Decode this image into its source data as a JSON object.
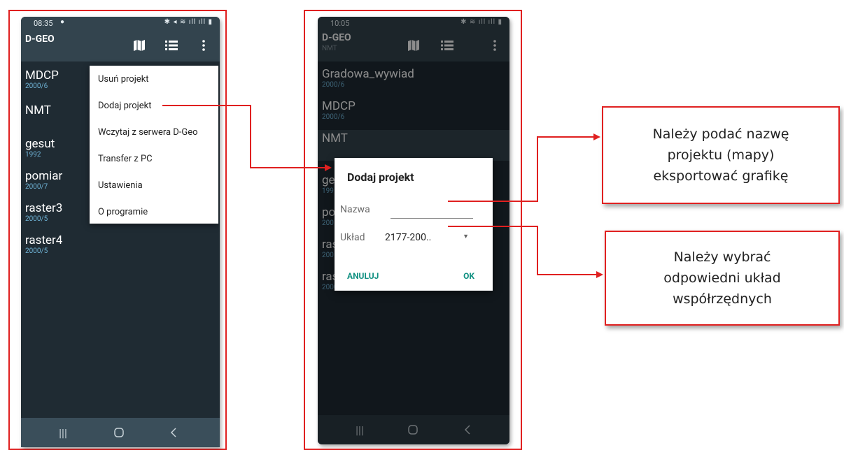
{
  "left_phone": {
    "status_time": "08:35",
    "app_title": "D-GEO",
    "projects": [
      {
        "name": "MDCP",
        "sub": "2000/6"
      },
      {
        "name": "NMT",
        "sub": ""
      },
      {
        "name": "gesut",
        "sub": "1992"
      },
      {
        "name": "pomiar",
        "sub": "2000/7"
      },
      {
        "name": "raster3",
        "sub": "2000/5"
      },
      {
        "name": "raster4",
        "sub": "2000/5"
      }
    ],
    "menu": [
      "Usuń projekt",
      "Dodaj projekt",
      "Wczytaj z serwera D-Geo",
      "Transfer z PC",
      "Ustawienia",
      "O programie"
    ]
  },
  "right_phone": {
    "status_time": "10:05",
    "app_title": "D-GEO",
    "app_subtitle": "NMT",
    "projects": [
      {
        "name": "Gradowa_wywiad",
        "sub": "2000/6"
      },
      {
        "name": "MDCP",
        "sub": "2000/6"
      },
      {
        "name": "NMT",
        "sub": ""
      },
      {
        "name": "ge",
        "sub": "199"
      },
      {
        "name": "po",
        "sub": "200"
      },
      {
        "name": "ras",
        "sub": "200"
      },
      {
        "name": "ras",
        "sub": "2000/5"
      }
    ],
    "dialog": {
      "title": "Dodaj projekt",
      "name_label": "Nazwa",
      "name_value": "",
      "system_label": "Układ",
      "system_value": "2177-200..",
      "cancel": "ANULUJ",
      "ok": "OK"
    }
  },
  "callouts": {
    "name_hint": [
      "Należy podać nazwę",
      "projektu (mapy)",
      "eksportować grafikę"
    ],
    "system_hint": [
      "Należy wybrać",
      "odpowiedni układ",
      "współrzędnych"
    ]
  },
  "colors": {
    "frame": "#e02020",
    "appbar": "#33444e",
    "list_bg": "#1f2b33",
    "sub_text": "#6fb3d6",
    "accent": "#0e8f80"
  }
}
